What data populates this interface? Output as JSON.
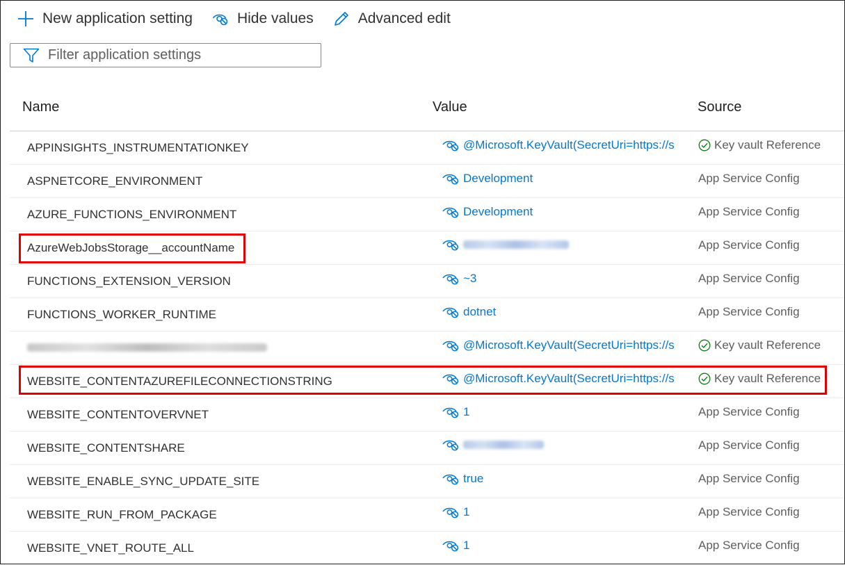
{
  "toolbar": {
    "new_label": "New application setting",
    "hide_label": "Hide values",
    "advanced_label": "Advanced edit"
  },
  "filter": {
    "placeholder": "Filter application settings"
  },
  "columns": {
    "name": "Name",
    "value": "Value",
    "source": "Source"
  },
  "colors": {
    "accent": "#0078d4",
    "highlight": "#e00000",
    "keyvault_check": "#107c10"
  },
  "rows": [
    {
      "name": "APPINSIGHTS_INSTRUMENTATIONKEY",
      "value": "@Microsoft.KeyVault(SecretUri=https://s",
      "source": "Key vault Reference"
    },
    {
      "name": "ASPNETCORE_ENVIRONMENT",
      "value": "Development",
      "source": "App Service Config"
    },
    {
      "name": "AZURE_FUNCTIONS_ENVIRONMENT",
      "value": "Development",
      "source": "App Service Config"
    },
    {
      "name": "AzureWebJobsStorage__accountName",
      "value": "",
      "source": "App Service Config"
    },
    {
      "name": "FUNCTIONS_EXTENSION_VERSION",
      "value": "~3",
      "source": "App Service Config"
    },
    {
      "name": "FUNCTIONS_WORKER_RUNTIME",
      "value": "dotnet",
      "source": "App Service Config"
    },
    {
      "name": "",
      "value": "@Microsoft.KeyVault(SecretUri=https://s",
      "source": "Key vault Reference"
    },
    {
      "name": "WEBSITE_CONTENTAZUREFILECONNECTIONSTRING",
      "value": "@Microsoft.KeyVault(SecretUri=https://s",
      "source": "Key vault Reference"
    },
    {
      "name": "WEBSITE_CONTENTOVERVNET",
      "value": "1",
      "source": "App Service Config"
    },
    {
      "name": "WEBSITE_CONTENTSHARE",
      "value": "",
      "source": "App Service Config"
    },
    {
      "name": "WEBSITE_ENABLE_SYNC_UPDATE_SITE",
      "value": "true",
      "source": "App Service Config"
    },
    {
      "name": "WEBSITE_RUN_FROM_PACKAGE",
      "value": "1",
      "source": "App Service Config"
    },
    {
      "name": "WEBSITE_VNET_ROUTE_ALL",
      "value": "1",
      "source": "App Service Config"
    }
  ]
}
